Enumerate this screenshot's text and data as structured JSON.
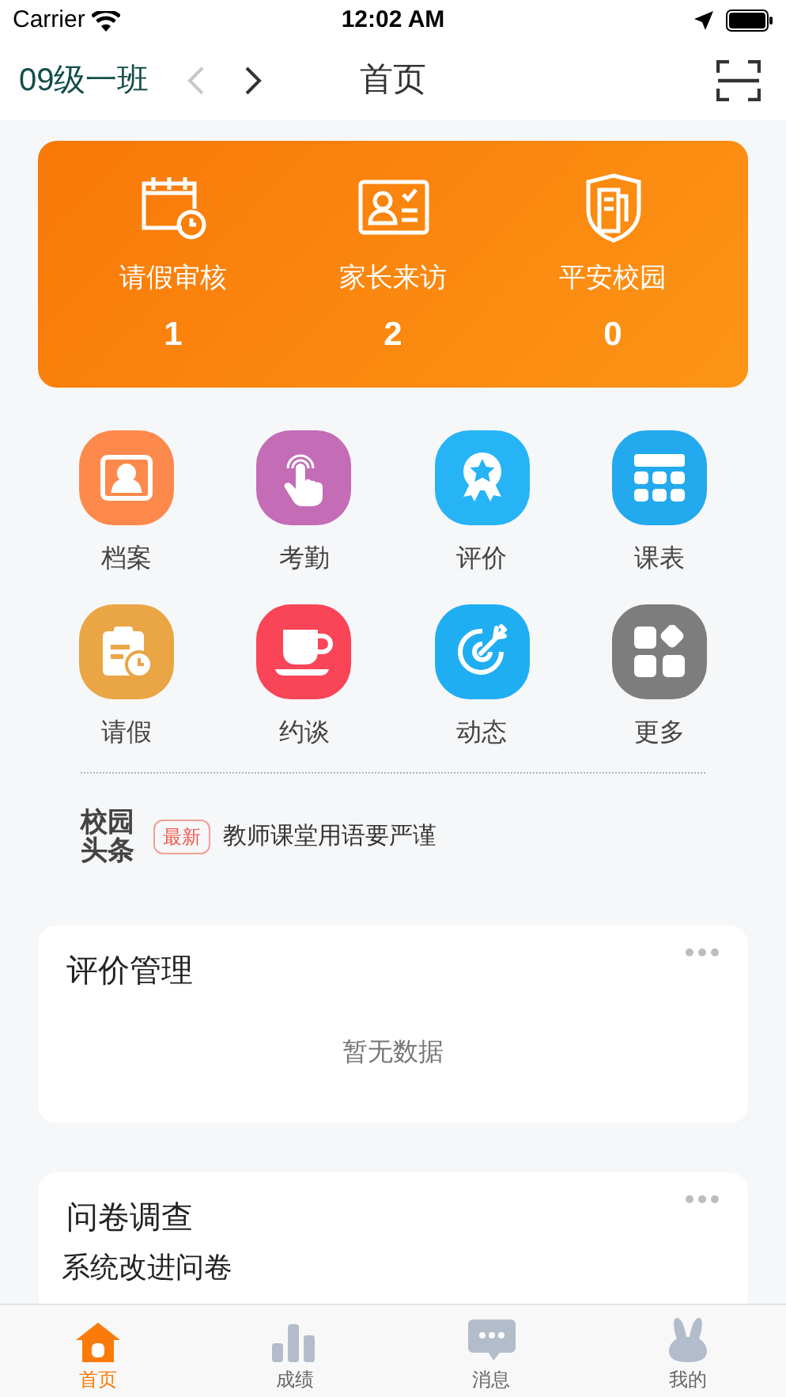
{
  "status_bar": {
    "carrier": "Carrier",
    "time": "12:02 AM"
  },
  "nav": {
    "class_name": "09级一班",
    "title": "首页"
  },
  "summary": [
    {
      "label": "请假审核",
      "count": "1"
    },
    {
      "label": "家长来访",
      "count": "2"
    },
    {
      "label": "平安校园",
      "count": "0"
    }
  ],
  "shortcuts": [
    {
      "label": "档案",
      "color": "#fd8a4c"
    },
    {
      "label": "考勤",
      "color": "#c46cb6"
    },
    {
      "label": "评价",
      "color": "#26b4f6"
    },
    {
      "label": "课表",
      "color": "#22a9ee"
    },
    {
      "label": "请假",
      "color": "#eaa545"
    },
    {
      "label": "约谈",
      "color": "#fa4458"
    },
    {
      "label": "动态",
      "color": "#20aef2"
    },
    {
      "label": "更多",
      "color": "#7d7d7d"
    }
  ],
  "headline": {
    "logo_top": "校园",
    "logo_bottom": "头条",
    "badge": "最新",
    "text": "教师课堂用语要严谨"
  },
  "cards": [
    {
      "title": "评价管理",
      "empty": "暂无数据"
    },
    {
      "title": "问卷调查",
      "items": [
        "系统改进问卷"
      ]
    }
  ],
  "tabs": [
    {
      "label": "首页",
      "selected": true
    },
    {
      "label": "成绩",
      "selected": false
    },
    {
      "label": "消息",
      "selected": false
    },
    {
      "label": "我的",
      "selected": false
    }
  ]
}
